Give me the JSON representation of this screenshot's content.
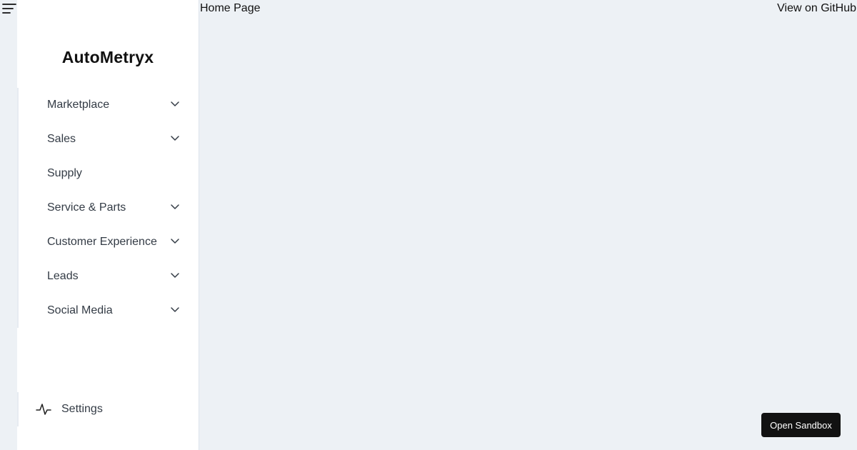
{
  "app": {
    "brand": "AutoMetryx",
    "header": {
      "title": "Home Page",
      "github_label": "View on GitHub"
    },
    "sidebar": {
      "items": [
        {
          "label": "Marketplace",
          "has_children": true
        },
        {
          "label": "Sales",
          "has_children": true
        },
        {
          "label": "Supply",
          "has_children": false
        },
        {
          "label": "Service & Parts",
          "has_children": true
        },
        {
          "label": "Customer Experience",
          "has_children": true
        },
        {
          "label": "Leads",
          "has_children": true
        },
        {
          "label": "Social Media",
          "has_children": true
        }
      ],
      "settings_label": "Settings"
    },
    "sandbox_label": "Open Sandbox"
  },
  "colors": {
    "background": "#edf1f5",
    "sidebar_bg": "#ffffff",
    "button_bg": "#121212",
    "button_text": "#ffffff"
  },
  "icons": {
    "menu": "hamburger-menu-icon",
    "expand": "chevron-down-icon",
    "settings": "activity-pulse-icon"
  }
}
